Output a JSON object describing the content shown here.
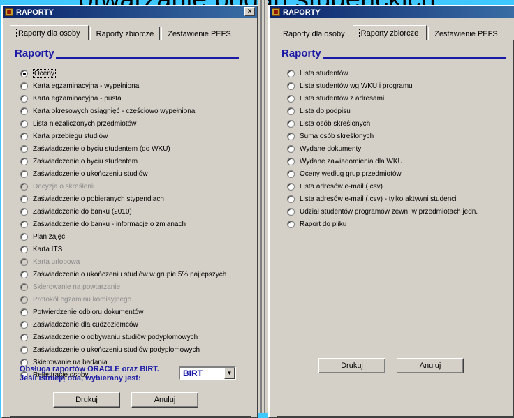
{
  "background_heading": "otwarzanie podań studenckich",
  "left_window": {
    "title": "RAPORTY",
    "close": "×",
    "tabs": [
      "Raporty dla osoby",
      "Raporty zbiorcze",
      "Zestawienie PEFS"
    ],
    "active_tab": 0,
    "section_title": "Raporty",
    "options": [
      {
        "label": "Oceny",
        "checked": true,
        "disabled": false
      },
      {
        "label": "Karta egzaminacyjna - wypełniona",
        "checked": false,
        "disabled": false
      },
      {
        "label": "Karta egzaminacyjna - pusta",
        "checked": false,
        "disabled": false
      },
      {
        "label": "Karta okresowych osiągnięć - częściowo wypełniona",
        "checked": false,
        "disabled": false
      },
      {
        "label": "Lista niezaliczonych przedmiotów",
        "checked": false,
        "disabled": false
      },
      {
        "label": "Karta przebiegu studiów",
        "checked": false,
        "disabled": false
      },
      {
        "label": "Zaświadczenie o byciu studentem (do WKU)",
        "checked": false,
        "disabled": false
      },
      {
        "label": "Zaświadczenie o byciu studentem",
        "checked": false,
        "disabled": false
      },
      {
        "label": "Zaświadczenie o ukończeniu studiów",
        "checked": false,
        "disabled": false
      },
      {
        "label": "Decyzja o skreśleniu",
        "checked": false,
        "disabled": true
      },
      {
        "label": "Zaświadczenie o pobieranych stypendiach",
        "checked": false,
        "disabled": false
      },
      {
        "label": "Zaświadczenie do banku (2010)",
        "checked": false,
        "disabled": false
      },
      {
        "label": "Zaświadczenie do banku - informacje o zmianach",
        "checked": false,
        "disabled": false
      },
      {
        "label": "Plan zajęć",
        "checked": false,
        "disabled": false
      },
      {
        "label": "Karta ITS",
        "checked": false,
        "disabled": false
      },
      {
        "label": "Karta urlopowa",
        "checked": false,
        "disabled": true
      },
      {
        "label": "Zaświadczenie o ukończeniu studiów w grupie 5% najlepszych",
        "checked": false,
        "disabled": false
      },
      {
        "label": "Skierowanie na powtarzanie",
        "checked": false,
        "disabled": true
      },
      {
        "label": "Protokół egzaminu komisyjnego",
        "checked": false,
        "disabled": true
      },
      {
        "label": "Potwierdzenie odbioru dokumentów",
        "checked": false,
        "disabled": false
      },
      {
        "label": "Zaświadczenie dla cudzoziemców",
        "checked": false,
        "disabled": false
      },
      {
        "label": "Zaświadczenie o odbywaniu studiów podyplomowych",
        "checked": false,
        "disabled": false
      },
      {
        "label": "Zaświadczenie o ukończeniu studiów podyplomowych",
        "checked": false,
        "disabled": false
      },
      {
        "label": "Skierowanie na badania",
        "checked": false,
        "disabled": false
      },
      {
        "label": "Rejestracje osoby",
        "checked": false,
        "disabled": false
      }
    ],
    "oracle_line1": "Obsługa raportów ORACLE oraz BIRT.",
    "oracle_line2": "Jeśli  istnieją oba, wybierany jest:",
    "select_value": "BIRT",
    "print_label": "Drukuj",
    "cancel_label": "Anuluj"
  },
  "right_window": {
    "title": "RAPORTY",
    "tabs": [
      "Raporty dla osoby",
      "Raporty zbiorcze",
      "Zestawienie PEFS"
    ],
    "active_tab": 1,
    "section_title": "Raporty",
    "options": [
      {
        "label": "Lista studentów",
        "checked": false
      },
      {
        "label": "Lista studentów wg WKU i programu",
        "checked": false
      },
      {
        "label": "Lista studentów z adresami",
        "checked": false
      },
      {
        "label": "Lista do podpisu",
        "checked": false
      },
      {
        "label": "Lista osób skreślonych",
        "checked": false
      },
      {
        "label": "Suma osób skreślonych",
        "checked": false
      },
      {
        "label": "Wydane dokumenty",
        "checked": false
      },
      {
        "label": "Wydane zawiadomienia dla WKU",
        "checked": false
      },
      {
        "label": "Oceny według grup przedmiotów",
        "checked": false
      },
      {
        "label": "Lista adresów e-mail (.csv)",
        "checked": false
      },
      {
        "label": "Lista adresów e-mail (.csv) - tylko aktywni studenci",
        "checked": false
      },
      {
        "label": "Udział studentów programów zewn. w przedmiotach jedn.",
        "checked": false
      },
      {
        "label": "Raport do pliku",
        "checked": false
      }
    ],
    "print_label": "Drukuj",
    "cancel_label": "Anuluj"
  }
}
